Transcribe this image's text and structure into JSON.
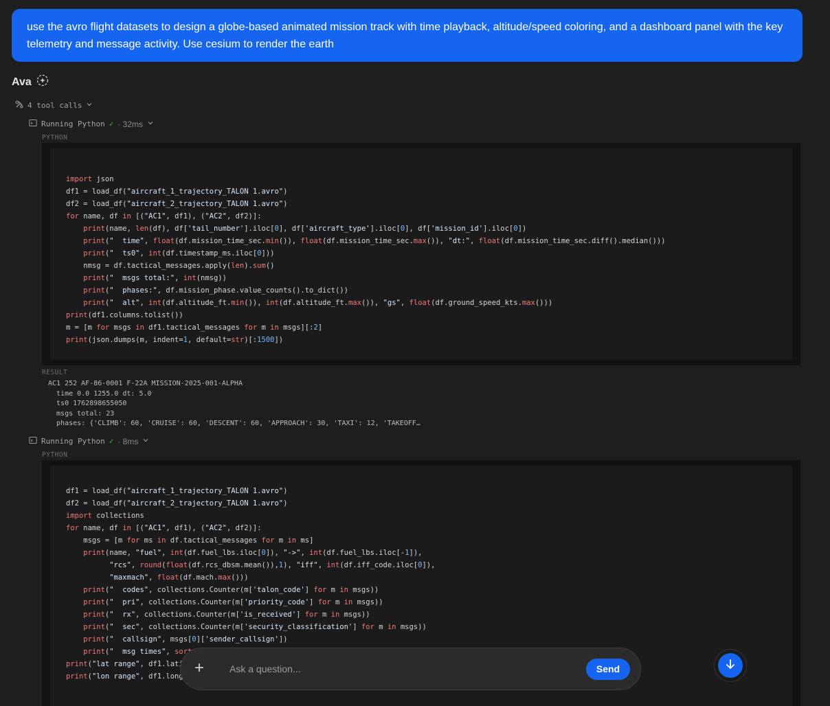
{
  "user_message": "use the avro flight datasets to design a globe-based animated mission track with time playback, altitude/speed coloring, and a dashboard panel with the key telemetry and message activity. Use cesium to render the earth",
  "assistant": {
    "name": "Ava",
    "tool_calls_label": "4 tool calls"
  },
  "runs": [
    {
      "label": "Running Python",
      "duration": "· 32ms",
      "language": "PYTHON"
    },
    {
      "label": "Running Python",
      "duration": "· 8ms",
      "language": "PYTHON"
    }
  ],
  "result": {
    "label": "RESULT",
    "lines": [
      "AC1 252 AF-86-0001 F-22A MISSION-2025-001-ALPHA",
      "  time 0.0 1255.0 dt: 5.0",
      "  ts0 1762898655050",
      "  msgs total: 23",
      "  phases: {'CLIMB': 60, 'CRUISE': 60, 'DESCENT': 60, 'APPROACH': 30, 'TAXI': 12, 'TAKEOFF…"
    ]
  },
  "chat": {
    "placeholder": "Ask a question...",
    "send_label": "Send"
  }
}
